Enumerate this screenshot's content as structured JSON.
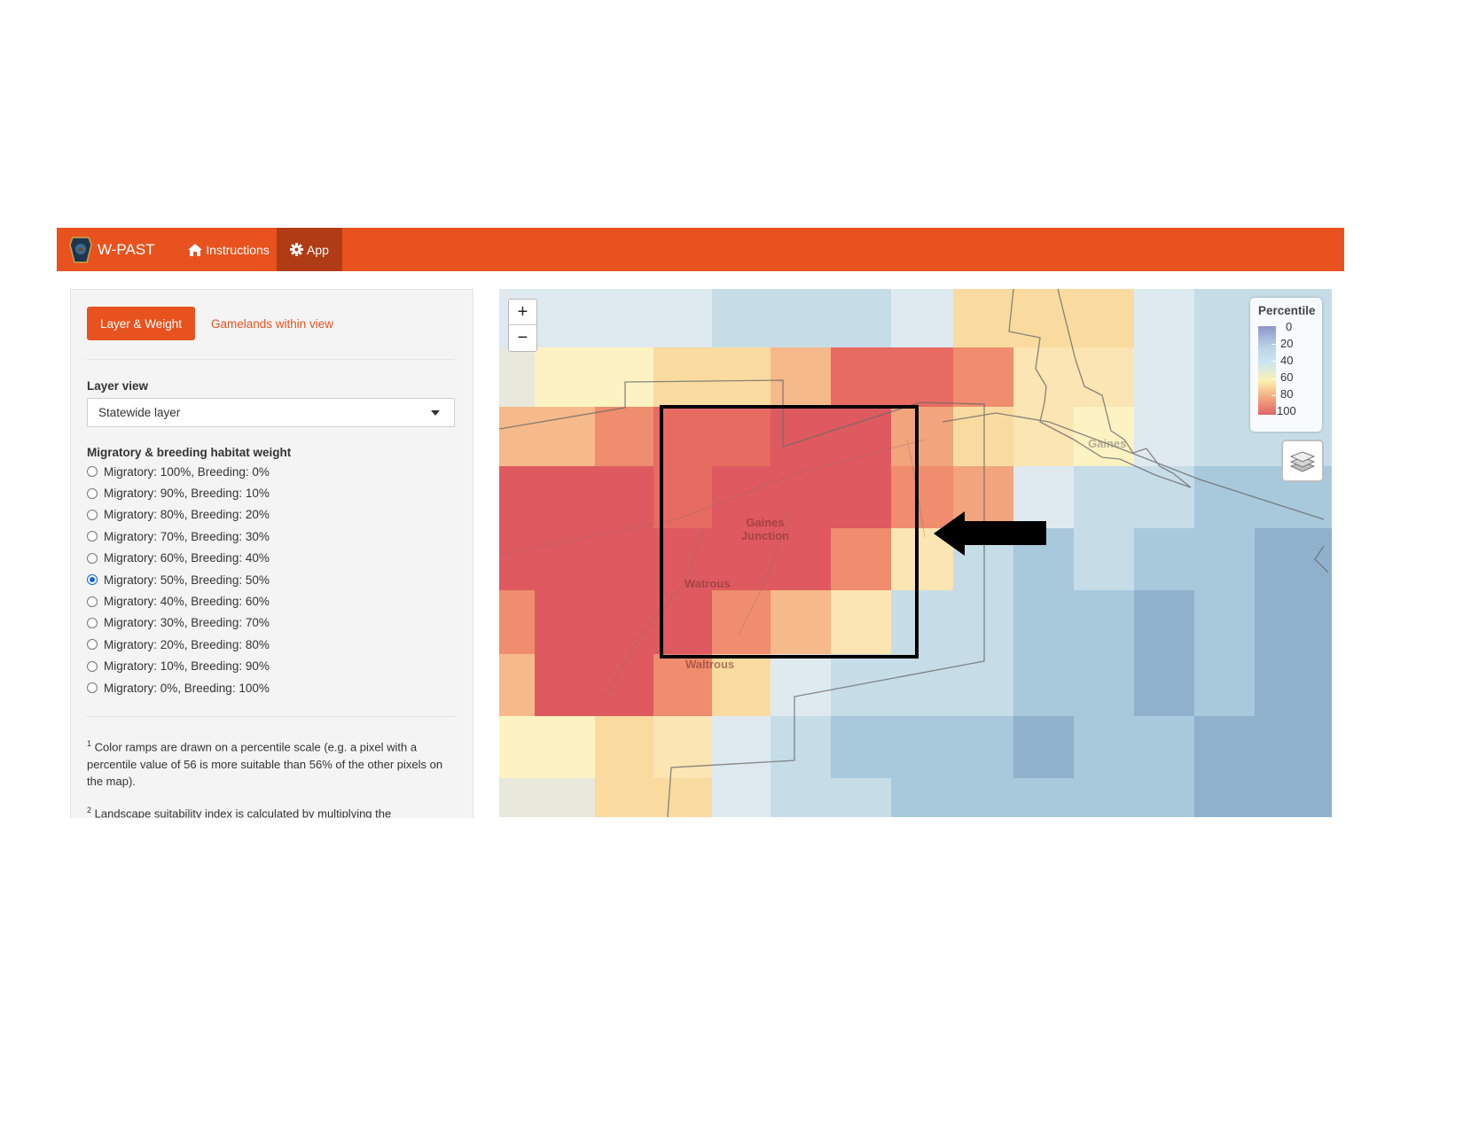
{
  "navbar": {
    "brand": "W-PAST",
    "instructions_label": "Instructions",
    "app_label": "App",
    "color": "#e8521e"
  },
  "sidebar": {
    "tabs": [
      "Layer & Weight",
      "Gamelands within view"
    ],
    "layer_view_label": "Layer view",
    "layer_view_value": "Statewide layer",
    "weight_label": "Migratory & breeding habitat weight",
    "options": [
      "Migratory: 100%, Breeding: 0%",
      "Migratory: 90%, Breeding: 10%",
      "Migratory: 80%, Breeding: 20%",
      "Migratory: 70%, Breeding: 30%",
      "Migratory: 60%, Breeding: 40%",
      "Migratory: 50%, Breeding: 50%",
      "Migratory: 40%, Breeding: 60%",
      "Migratory: 30%, Breeding: 70%",
      "Migratory: 20%, Breeding: 80%",
      "Migratory: 10%, Breeding: 90%",
      "Migratory: 0%, Breeding: 100%"
    ],
    "selected_option": "Migratory: 50%, Breeding: 50%",
    "footnotes": [
      {
        "num": "1",
        "text": "Color ramps are drawn on a percentile scale (e.g. a pixel with a percentile value of 56 is more suitable than 56% of the other pixels on the map)."
      },
      {
        "num": "2",
        "text": "Landscape suitability index is calculated by multiplying the"
      }
    ]
  },
  "map": {
    "zoom_in": "+",
    "zoom_out": "−",
    "legend": {
      "title": "Percentile",
      "labels": [
        "0",
        "20",
        "40",
        "60",
        "80",
        "100"
      ],
      "colors": [
        "#8f96c9",
        "#bcd6e8",
        "#cfe5ee",
        "#fbf0b0",
        "#f5a27a",
        "#e2646c"
      ]
    },
    "places": [
      "Gaines Junction",
      "Watrous",
      "Waltrous",
      "Gaines"
    ],
    "layers_icon": "layers-icon"
  }
}
